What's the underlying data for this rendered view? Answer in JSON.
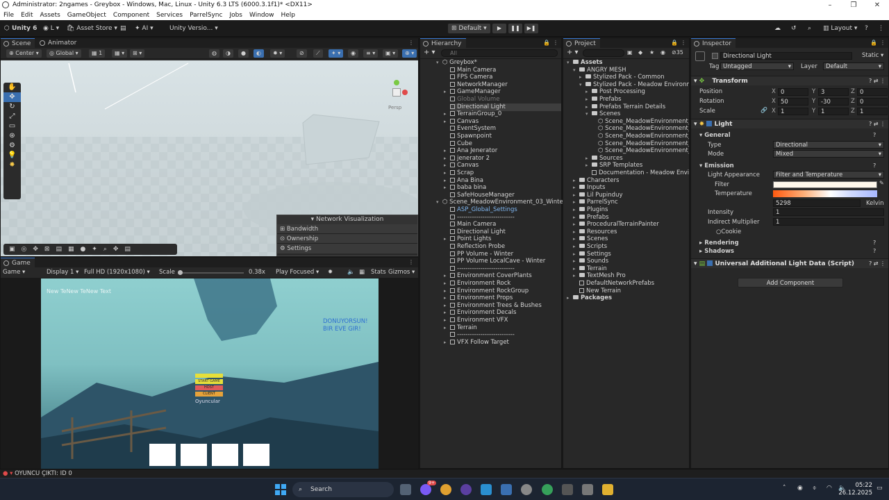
{
  "window": {
    "title": "Administrator: 2ngames - Greybox - Windows, Mac, Linux - Unity 6.3 LTS (6000.3.1f1)* <DX11>",
    "minimize": "–",
    "maximize": "❐",
    "close": "✕"
  },
  "menu": [
    "File",
    "Edit",
    "Assets",
    "GameObject",
    "Component",
    "Services",
    "ParrelSync",
    "Jobs",
    "Window",
    "Help"
  ],
  "toolbar": {
    "unity_label": "Unity 6",
    "account": "L",
    "asset_store": "Asset Store",
    "ai": "AI",
    "version": "Unity Versio...",
    "layout_mode": "Default",
    "layout": "Layout"
  },
  "scene": {
    "tabs": [
      "Scene",
      "Animator"
    ],
    "pivot": "Center",
    "space": "Global",
    "grid_snap": "1",
    "persp_label": "Persp",
    "network_vis": {
      "title": "Network Visualization",
      "items": [
        "Bandwidth",
        "Ownership",
        "Settings"
      ]
    }
  },
  "game": {
    "tab": "Game",
    "view": "Game",
    "display": "Display 1",
    "resolution": "Full HD (1920x1080)",
    "scale_label": "Scale",
    "scale_value": "0.38x",
    "play_focus": "Play Focused",
    "stats": "Stats",
    "gizmos": "Gizmos",
    "overlay_top_left": "New TeNew TeNew Text",
    "overlay_right_1": "DONUYORSUN!",
    "overlay_right_2": "BIR EVE GIR!",
    "menu_buttons": [
      "START GAME",
      "HOST",
      "CLIENT"
    ],
    "menu_hint": "Oyuncular"
  },
  "status": {
    "message": "OYUNCU ÇIKTI: ID 0"
  },
  "hierarchy": {
    "tab": "Hierarchy",
    "search_placeholder": "All",
    "scene1": "Greybox*",
    "scene1_items": [
      "Main Camera",
      "FPS Camera",
      "NetworkManager",
      "GameManager",
      "Global Volume",
      "Directional Light",
      "TerrainGroup_0",
      "Canvas",
      "EventSystem",
      "Spawnpoint",
      "Cube",
      "Ana Jenerator",
      "jenerator 2",
      "Canvas",
      "Scrap",
      "Ana Bina",
      "baba bina",
      "SafeHouseManager"
    ],
    "scene2": "Scene_MeadowEnvironment_03_Winter",
    "scene2_items": [
      "ASP_Global_Settings",
      "---------------------------",
      "Main Camera",
      "Directional Light",
      "Point Lights",
      "Reflection Probe",
      "PP Volume - Winter",
      "PP Volume LocalCave - Winter",
      "---------------------------",
      "Environment CoverPlants",
      "Environment Rock",
      "Environment RockGroup",
      "Environment Props",
      "Environment Trees & Bushes",
      "Environment Decals",
      "Environment VFX",
      "Terrain",
      "---------------------------",
      "VFX Follow Target"
    ]
  },
  "project": {
    "tab": "Project",
    "hidden_count": "35",
    "items": [
      {
        "t": "Assets",
        "d": 0
      },
      {
        "t": "ANGRY MESH",
        "d": 1
      },
      {
        "t": "Stylized Pack - Common",
        "d": 2
      },
      {
        "t": "Stylized Pack - Meadow Environment",
        "d": 2
      },
      {
        "t": "Post Processing",
        "d": 3
      },
      {
        "t": "Prefabs",
        "d": 3
      },
      {
        "t": "Prefabs Terrain Details",
        "d": 3
      },
      {
        "t": "Scenes",
        "d": 3
      },
      {
        "t": "Scene_MeadowEnvironment_01_",
        "d": 4
      },
      {
        "t": "Scene_MeadowEnvironment_02_",
        "d": 4
      },
      {
        "t": "Scene_MeadowEnvironment_03_",
        "d": 4
      },
      {
        "t": "Scene_MeadowEnvironment_04_",
        "d": 4
      },
      {
        "t": "Scene_MeadowEnvironment_05_",
        "d": 4
      },
      {
        "t": "Sources",
        "d": 3
      },
      {
        "t": "SRP Templates",
        "d": 3
      },
      {
        "t": "Documentation - Meadow Environ",
        "d": 3
      },
      {
        "t": "Characters",
        "d": 1
      },
      {
        "t": "Inputs",
        "d": 1
      },
      {
        "t": "Lil Pupinduy",
        "d": 1
      },
      {
        "t": "ParrelSync",
        "d": 1
      },
      {
        "t": "Plugins",
        "d": 1
      },
      {
        "t": "Prefabs",
        "d": 1
      },
      {
        "t": "ProceduralTerrainPainter",
        "d": 1
      },
      {
        "t": "Resources",
        "d": 1
      },
      {
        "t": "Scenes",
        "d": 1
      },
      {
        "t": "Scripts",
        "d": 1
      },
      {
        "t": "Settings",
        "d": 1
      },
      {
        "t": "Sounds",
        "d": 1
      },
      {
        "t": "Terrain",
        "d": 1
      },
      {
        "t": "TextMesh Pro",
        "d": 1
      },
      {
        "t": "DefaultNetworkPrefabs",
        "d": 1
      },
      {
        "t": "New Terrain",
        "d": 1
      },
      {
        "t": "Packages",
        "d": 0
      }
    ]
  },
  "inspector": {
    "tab": "Inspector",
    "object_name": "Directional Light",
    "static_label": "Static",
    "tag_label": "Tag",
    "tag_value": "Untagged",
    "layer_label": "Layer",
    "layer_value": "Default",
    "transform": {
      "title": "Transform",
      "position_label": "Position",
      "rotation_label": "Rotation",
      "scale_label": "Scale",
      "position": [
        "0",
        "3",
        "0"
      ],
      "rotation": [
        "50",
        "-30",
        "0"
      ],
      "scale": [
        "1",
        "1",
        "1"
      ]
    },
    "light": {
      "title": "Light",
      "general": "General",
      "type_label": "Type",
      "type_value": "Directional",
      "mode_label": "Mode",
      "mode_value": "Mixed",
      "emission": "Emission",
      "appearance_label": "Light Appearance",
      "appearance_value": "Filter and Temperature",
      "filter_label": "Filter",
      "temperature_label": "Temperature",
      "temperature_value": "5298",
      "temperature_unit": "Kelvin",
      "intensity_label": "Intensity",
      "intensity_value": "1",
      "indirect_label": "Indirect Multiplier",
      "indirect_value": "1",
      "cookie_label": "Cookie",
      "rendering": "Rendering",
      "shadows": "Shadows"
    },
    "urp_component": "Universal Additional Light Data (Script)",
    "add_component": "Add Component"
  },
  "taskbar": {
    "search": "Search",
    "time": "05:22",
    "date": "26.12.2025",
    "badge": "9+"
  }
}
